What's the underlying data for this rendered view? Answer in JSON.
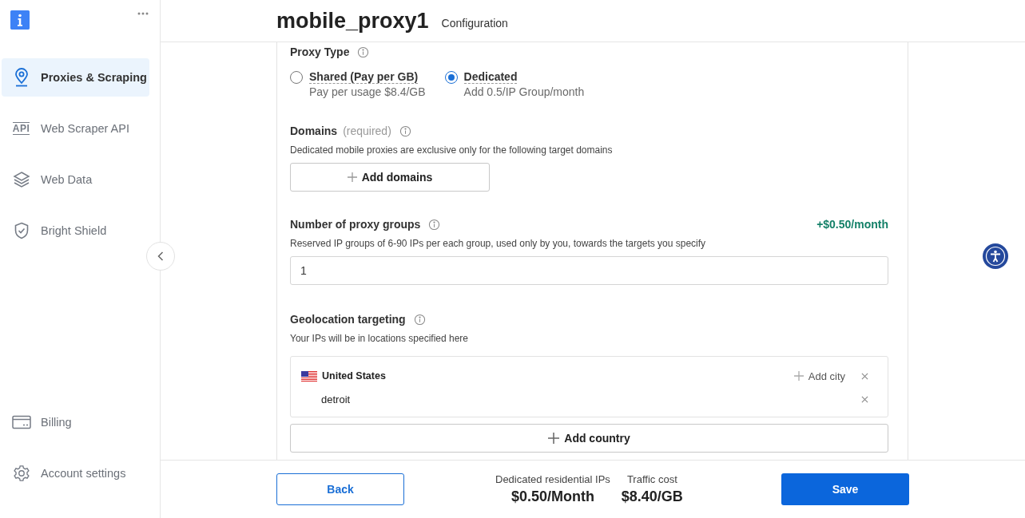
{
  "sidebar": {
    "items": [
      {
        "label": "Proxies & Scraping",
        "kind": "pin",
        "selected": true
      },
      {
        "label": "Web Scraper API",
        "kind": "api",
        "icon_text": "API",
        "selected": false
      },
      {
        "label": "Web Data",
        "kind": "layers",
        "selected": false
      },
      {
        "label": "Bright Shield",
        "kind": "shield",
        "selected": false
      }
    ],
    "bottom_items": [
      {
        "label": "Billing",
        "kind": "card",
        "selected": false
      },
      {
        "label": "Account settings",
        "kind": "gear",
        "selected": false
      }
    ]
  },
  "header": {
    "title": "mobile_proxy1",
    "subtitle": "Configuration"
  },
  "proxy_type": {
    "label": "Proxy Type",
    "options": [
      {
        "label": "Shared (Pay per GB)",
        "description": "Pay per usage $8.4/GB",
        "selected": false
      },
      {
        "label": "Dedicated",
        "description": "Add 0.5/IP Group/month",
        "selected": true
      }
    ]
  },
  "domains": {
    "label": "Domains",
    "note": "(required)",
    "description": "Dedicated mobile proxies are exclusive only for the following target domains",
    "button": "Add domains"
  },
  "proxy_groups": {
    "label": "Number of proxy groups",
    "price": "+$0.50/month",
    "description": "Reserved IP groups of 6-90 IPs per each group, used only by you, towards the targets you specify",
    "value": "1"
  },
  "geolocation": {
    "label": "Geolocation targeting",
    "description": "Your IPs will be in locations specified here",
    "countries": [
      {
        "name": "United States",
        "add_city": "Add city",
        "cities": [
          "detroit"
        ]
      }
    ],
    "add_country": "Add country"
  },
  "footer": {
    "back": "Back",
    "costs": [
      {
        "label": "Dedicated residential IPs",
        "value": "$0.50/Month"
      },
      {
        "label": "Traffic cost",
        "value": "$8.40/GB"
      }
    ],
    "save": "Save"
  }
}
